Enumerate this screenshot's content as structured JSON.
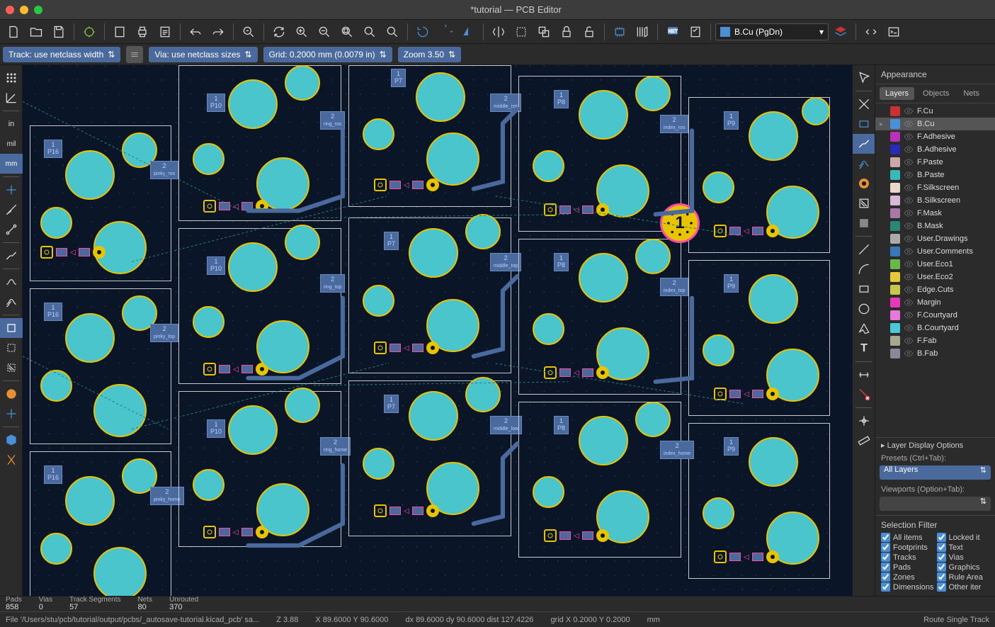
{
  "window": {
    "title": "*tutorial — PCB Editor"
  },
  "toolbar": {
    "layer_selected": "B.Cu (PgDn)"
  },
  "options": {
    "track": "Track: use netclass width",
    "via": "Via: use netclass sizes",
    "grid": "Grid: 0.2000 mm (0.0079 in)",
    "zoom": "Zoom 3.50"
  },
  "appearance": {
    "title": "Appearance",
    "tabs": [
      "Layers",
      "Objects",
      "Nets"
    ],
    "active_tab": "Layers",
    "layers": [
      {
        "name": "F.Cu",
        "color": "#c83232",
        "active": false
      },
      {
        "name": "B.Cu",
        "color": "#4a90d9",
        "active": true
      },
      {
        "name": "F.Adhesive",
        "color": "#b832b8",
        "active": false
      },
      {
        "name": "B.Adhesive",
        "color": "#2a2ab8",
        "active": false
      },
      {
        "name": "F.Paste",
        "color": "#c8a8a8",
        "active": false
      },
      {
        "name": "B.Paste",
        "color": "#38b8b8",
        "active": false
      },
      {
        "name": "F.Silkscreen",
        "color": "#e8d8c8",
        "active": false
      },
      {
        "name": "B.Silkscreen",
        "color": "#d8b8d8",
        "active": false
      },
      {
        "name": "F.Mask",
        "color": "#a878a8",
        "active": false
      },
      {
        "name": "B.Mask",
        "color": "#288878",
        "active": false
      },
      {
        "name": "User.Drawings",
        "color": "#aaaaaa",
        "active": false
      },
      {
        "name": "User.Comments",
        "color": "#3878b8",
        "active": false
      },
      {
        "name": "User.Eco1",
        "color": "#68b848",
        "active": false
      },
      {
        "name": "User.Eco2",
        "color": "#e8c838",
        "active": false
      },
      {
        "name": "Edge.Cuts",
        "color": "#c8c848",
        "active": false
      },
      {
        "name": "Margin",
        "color": "#e838b8",
        "active": false
      },
      {
        "name": "F.Courtyard",
        "color": "#e878d8",
        "active": false
      },
      {
        "name": "B.Courtyard",
        "color": "#48c8d8",
        "active": false
      },
      {
        "name": "F.Fab",
        "color": "#a8a890",
        "active": false
      },
      {
        "name": "B.Fab",
        "color": "#888898",
        "active": false
      }
    ],
    "display_options": "Layer Display Options",
    "presets_label": "Presets (Ctrl+Tab):",
    "presets_value": "All Layers",
    "viewports_label": "Viewports (Option+Tab):",
    "viewports_value": ""
  },
  "selection_filter": {
    "title": "Selection Filter",
    "items": [
      {
        "label": "All items",
        "checked": true
      },
      {
        "label": "Locked it",
        "checked": true
      },
      {
        "label": "Footprints",
        "checked": true
      },
      {
        "label": "Text",
        "checked": true
      },
      {
        "label": "Tracks",
        "checked": true
      },
      {
        "label": "Vias",
        "checked": true
      },
      {
        "label": "Pads",
        "checked": true
      },
      {
        "label": "Graphics",
        "checked": true
      },
      {
        "label": "Zones",
        "checked": true
      },
      {
        "label": "Rule Area",
        "checked": true
      },
      {
        "label": "Dimensions",
        "checked": true
      },
      {
        "label": "Other iter",
        "checked": true
      }
    ]
  },
  "infobar": {
    "pads": {
      "label": "Pads",
      "value": "858"
    },
    "vias": {
      "label": "Vias",
      "value": "0"
    },
    "tracks": {
      "label": "Track Segments",
      "value": "57"
    },
    "nets": {
      "label": "Nets",
      "value": "80"
    },
    "unrouted": {
      "label": "Unrouted",
      "value": "370"
    }
  },
  "statusbar": {
    "file": "File '/Users/stu/pcb/tutorial/output/pcbs/_autosave-tutorial.kicad_pcb' sa...",
    "z": "Z 3.88",
    "xy": "X 89.6000  Y 90.6000",
    "dxy": "dx 89.6000  dy 90.6000  dist 127.4226",
    "grid": "grid X 0.2000  Y 0.2000",
    "units": "mm",
    "mode": "Route Single Track"
  },
  "refs": {
    "p16": "P16",
    "p10": "P10",
    "p7": "P7",
    "p8": "P8",
    "p9": "P9",
    "one": "1",
    "two": "2",
    "pinky": "pinky_ros",
    "ring": "ring_ros",
    "middle": "middle_ros",
    "index": "index_ros",
    "highlight_text": "1"
  }
}
